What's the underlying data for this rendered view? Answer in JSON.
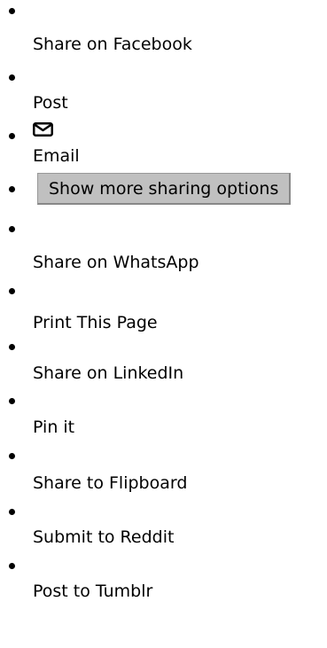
{
  "share_menu": {
    "items": [
      {
        "label": "Share on Facebook",
        "icon": "facebook-icon"
      },
      {
        "label": "Post",
        "icon": "x-twitter-icon"
      },
      {
        "label": "Email",
        "icon": "mail-icon"
      },
      {
        "label": "Show more sharing options",
        "icon": ""
      },
      {
        "label": "Share on WhatsApp",
        "icon": "whatsapp-icon"
      },
      {
        "label": "Print This Page",
        "icon": "print-icon"
      },
      {
        "label": "Share on LinkedIn",
        "icon": "linkedin-icon"
      },
      {
        "label": "Pin it",
        "icon": "pinterest-icon"
      },
      {
        "label": "Share to Flipboard",
        "icon": "flipboard-icon"
      },
      {
        "label": "Submit to Reddit",
        "icon": "reddit-icon"
      },
      {
        "label": "Post to Tumblr",
        "icon": "tumblr-icon"
      }
    ]
  }
}
